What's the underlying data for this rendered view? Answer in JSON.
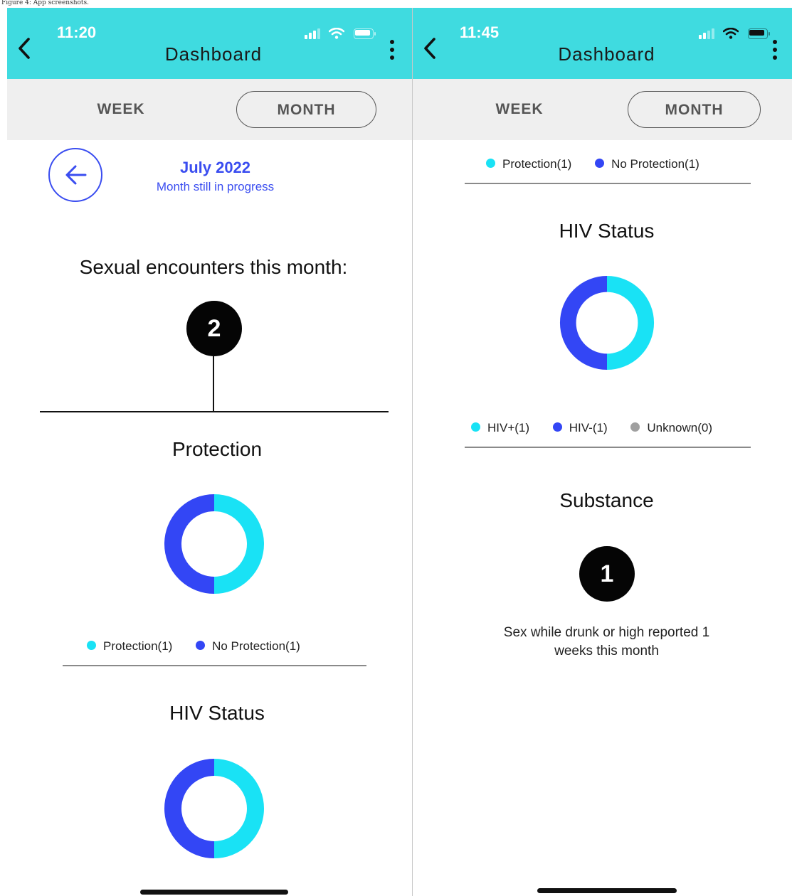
{
  "caption": "Figure 4: App screenshots.",
  "colors": {
    "header": "#3fdbe0",
    "cyan": "#19e2f5",
    "blue": "#3346f5",
    "gray": "#a0a0a0",
    "link": "#3a4df0"
  },
  "left": {
    "time": "11:20",
    "title": "Dashboard",
    "tabs": {
      "week": "WEEK",
      "month": "MONTH",
      "active": "month"
    },
    "month_label": "July 2022",
    "month_sub": "Month still in progress",
    "encounters_title": "Sexual encounters this month:",
    "encounters_count": "2",
    "protection_title": "Protection",
    "protection_legend": [
      "Protection(1)",
      "No Protection(1)"
    ],
    "hiv_title": "HIV Status"
  },
  "right": {
    "time": "11:45",
    "title": "Dashboard",
    "tabs": {
      "week": "WEEK",
      "month": "MONTH",
      "active": "month"
    },
    "protection_legend": [
      "Protection(1)",
      "No Protection(1)"
    ],
    "hiv_title": "HIV Status",
    "hiv_legend": [
      "HIV+(1)",
      "HIV-(1)",
      "Unknown(0)"
    ],
    "substance_title": "Substance",
    "substance_count": "1",
    "substance_text_1": "Sex while drunk or high reported 1",
    "substance_text_2": "weeks this month"
  },
  "chart_data": [
    {
      "type": "pie",
      "title": "Protection",
      "categories": [
        "Protection",
        "No Protection"
      ],
      "values": [
        1,
        1
      ],
      "colors": [
        "#19e2f5",
        "#3346f5"
      ]
    },
    {
      "type": "pie",
      "title": "HIV Status",
      "categories": [
        "HIV+",
        "HIV-",
        "Unknown"
      ],
      "values": [
        1,
        1,
        0
      ],
      "colors": [
        "#19e2f5",
        "#3346f5",
        "#a0a0a0"
      ]
    }
  ]
}
